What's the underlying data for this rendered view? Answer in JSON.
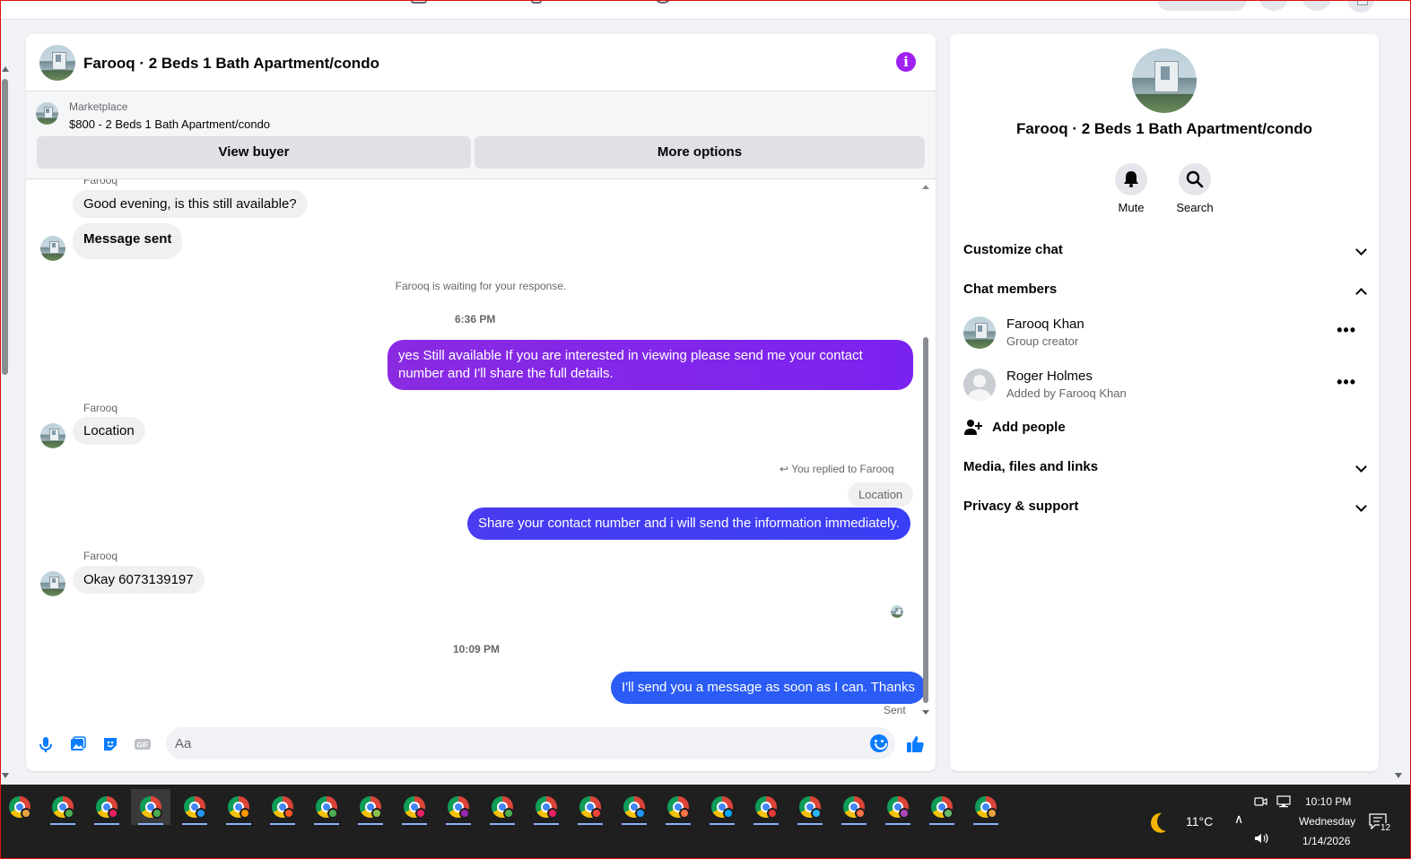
{
  "conversation": {
    "title": "Farooq · 2 Beds 1 Bath Apartment/condo"
  },
  "marketplace": {
    "label": "Marketplace",
    "listing": "$800 - 2 Beds 1 Bath Apartment/condo",
    "view_buyer": "View buyer",
    "more_options": "More options"
  },
  "messages": {
    "sender_top": "Farooq",
    "m1": "Good evening, is this still available?",
    "m2": "Message sent",
    "waiting": "Farooq is waiting for your response.",
    "ts1": "6:36 PM",
    "out1": "yes Still available If you are interested in viewing please send me your contact number and I'll share the full details.",
    "sender2": "Farooq",
    "m3": "Location",
    "reply_note": "You replied to Farooq",
    "reply_quote": "Location",
    "out2": "Share your contact number and i will send the information immediately.",
    "sender3": "Farooq",
    "m4": "Okay 6073139197",
    "ts2": "10:09 PM",
    "out3": "I'll send you a message as soon as I can. Thanks",
    "status": "Sent"
  },
  "composer": {
    "placeholder": "Aa"
  },
  "side": {
    "title": "Farooq · 2 Beds 1 Bath Apartment/condo",
    "mute": "Mute",
    "search": "Search",
    "customize": "Customize chat",
    "members_header": "Chat members",
    "members": [
      {
        "name": "Farooq Khan",
        "sub": "Group creator"
      },
      {
        "name": "Roger Holmes",
        "sub": "Added by Farooq Khan"
      }
    ],
    "add_people": "Add people",
    "media": "Media, files and links",
    "privacy": "Privacy & support"
  },
  "taskbar": {
    "weather": "11°C",
    "time": "10:10 PM",
    "day": "Wednesday",
    "date": "1/14/2026",
    "notifications": "12"
  },
  "colors": {
    "accent": "#a020f0",
    "bubble_out_1": "#8a2be2",
    "bubble_out_2": "#4a3cf0",
    "bubble_out_3": "#2b5cf5",
    "like": "#0a7cff"
  }
}
